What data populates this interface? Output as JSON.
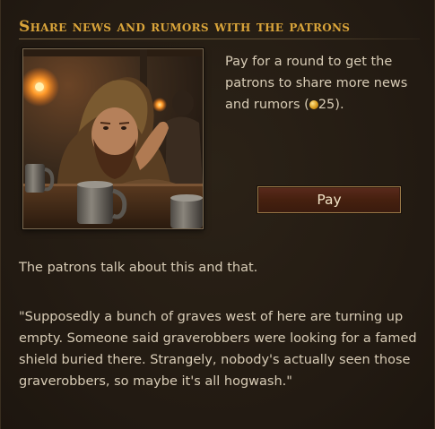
{
  "event": {
    "title": "Share news and rumors with the patrons",
    "description_before": "Pay for a round to get the patrons to share more news and rumors (",
    "cost": "25",
    "description_after": ").",
    "pay_label": "Pay",
    "result_text": "The patrons talk about this and that.",
    "quote": "\"Supposedly a bunch of graves west of here are turning up empty. Someone said graverobbers were looking for a famed shield buried there. Strangely, nobody's actually seen those graverobbers, so maybe it's all hogwash.\""
  },
  "icons": {
    "cost_icon": "gold-coin-icon"
  },
  "colors": {
    "title": "#d9a43a",
    "text": "#d8ccb6",
    "button_bg": "#4a2214",
    "button_border": "#9a7a48",
    "background": "#231c13"
  }
}
